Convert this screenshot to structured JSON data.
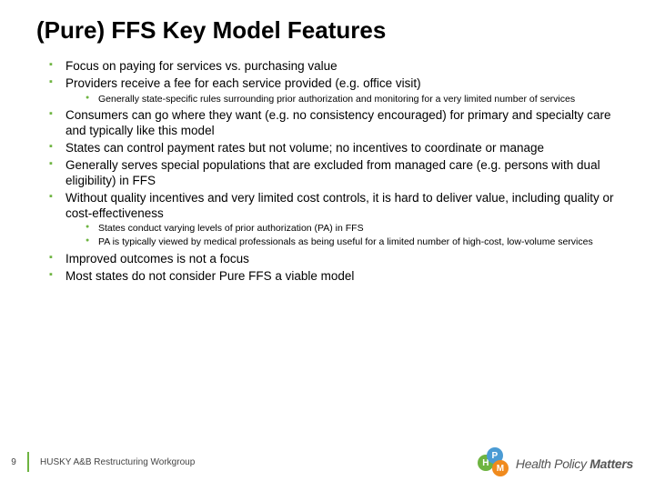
{
  "title": "(Pure) FFS Key Model Features",
  "bullets": [
    {
      "text": "Focus on paying for services vs. purchasing value"
    },
    {
      "text": "Providers receive a fee for each service provided (e.g. office visit)",
      "sub": [
        "Generally state-specific rules surrounding prior authorization and monitoring for a very limited number of services"
      ]
    },
    {
      "text": "Consumers can go where they want (e.g. no consistency encouraged) for primary and specialty care and typically like this model"
    },
    {
      "text": "States can control payment rates but not volume; no incentives to coordinate or manage"
    },
    {
      "text": "Generally serves special populations that are excluded from managed care (e.g. persons with dual eligibility) in FFS"
    },
    {
      "text": "Without quality incentives and very limited cost controls, it is hard to deliver value, including quality or cost-effectiveness",
      "sub": [
        "States conduct varying levels of prior authorization (PA) in FFS",
        "PA is typically viewed by medical professionals as being useful for a limited number of high-cost, low-volume services"
      ]
    },
    {
      "text": "Improved outcomes is not a focus"
    },
    {
      "text": "Most states do not consider Pure FFS a viable model"
    }
  ],
  "footer": {
    "page": "9",
    "text": "HUSKY A&B Restructuring Workgroup"
  },
  "logo": {
    "word1": "Health",
    "word2": "Policy",
    "word3": "Matters"
  }
}
